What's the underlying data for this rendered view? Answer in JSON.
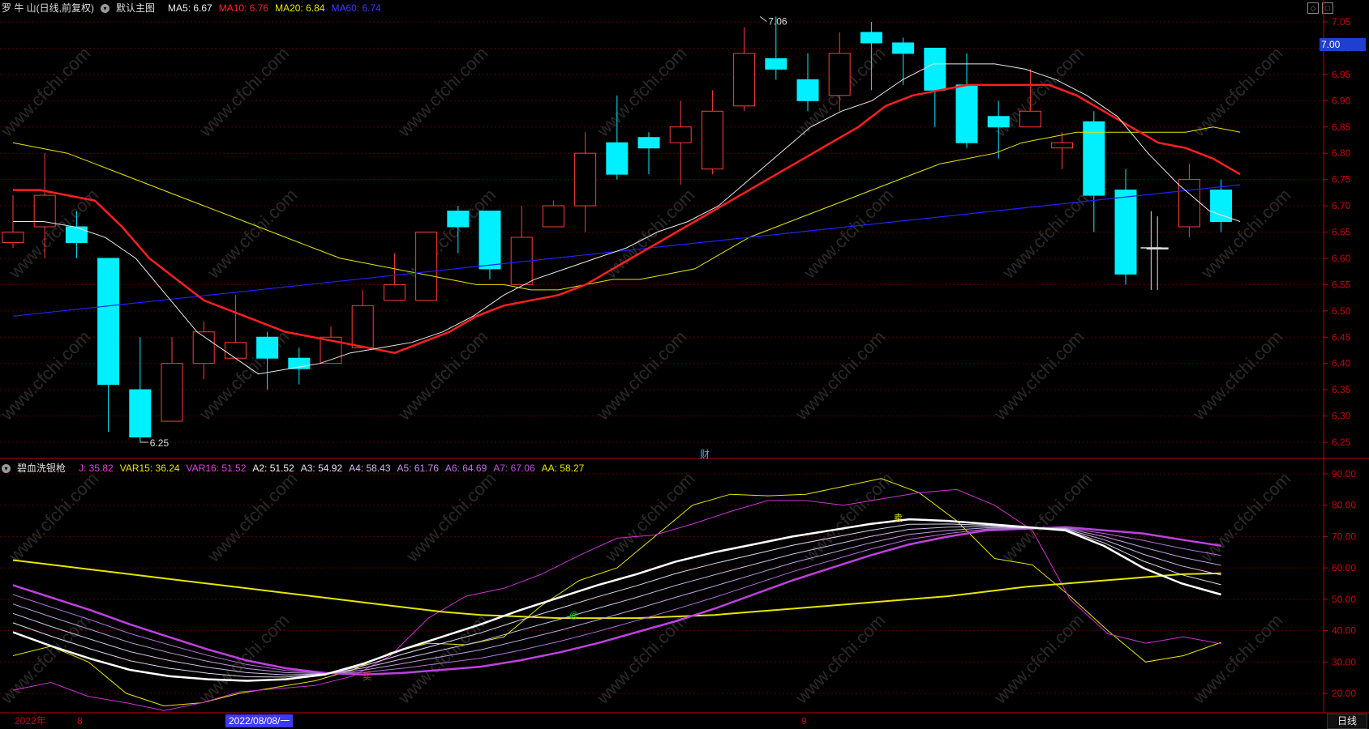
{
  "header_top": {
    "stock": "罗 牛 山(日线,前复权)",
    "main_label": "默认主图",
    "ma5": "MA5: 6.67",
    "ma10": "MA10: 6.76",
    "ma20": "MA20: 6.84",
    "ma60": "MA60: 6.74"
  },
  "header_bottom": {
    "indicator": "碧血洗银枪",
    "j": "J: 35.82",
    "var15": "VAR15: 36.24",
    "var16": "VAR16: 51.52",
    "a2": "A2: 51.52",
    "a3": "A3: 54.92",
    "a4": "A4: 58.43",
    "a5": "A5: 61.76",
    "a6": "A6: 64.69",
    "a7": "A7: 67.06",
    "aa": "AA: 58.27"
  },
  "colors": {
    "up": "#ff3b3b",
    "down": "#00f0ff",
    "ma5": "#e8e8e8",
    "ma10": "#ff1f1f",
    "ma20": "#e6e600",
    "ma60": "#2020ff",
    "grid": "#5a0000",
    "axis": "#c00000"
  },
  "price_axis": {
    "ticks": [
      "7.05",
      "7.00",
      "6.95",
      "6.90",
      "6.85",
      "6.80",
      "6.75",
      "6.70",
      "6.65",
      "6.60",
      "6.55",
      "6.50",
      "6.45",
      "6.40",
      "6.35",
      "6.30",
      "6.25"
    ],
    "current_price": "7.00"
  },
  "indicator_axis": {
    "ticks": [
      "90.00",
      "80.00",
      "70.00",
      "60.00",
      "50.00",
      "40.00",
      "30.00",
      "20.00"
    ]
  },
  "annotations": {
    "high": "7.06",
    "low": "6.25",
    "cai": "财",
    "signal_top": "卖",
    "signal_mid": "@",
    "signal_bottom": "买"
  },
  "x_axis": {
    "year": "2022年",
    "month8": "8",
    "cursor_date": "2022/08/08/一",
    "month9": "9",
    "period_button": "日线"
  },
  "watermark": "www.cfchi.com",
  "chart_data": {
    "type": "candlestick",
    "candles": [
      {
        "o": 6.63,
        "h": 6.72,
        "l": 6.62,
        "c": 6.65
      },
      {
        "o": 6.66,
        "h": 6.8,
        "l": 6.6,
        "c": 6.72
      },
      {
        "o": 6.66,
        "h": 6.69,
        "l": 6.6,
        "c": 6.63
      },
      {
        "o": 6.6,
        "h": 6.6,
        "l": 6.27,
        "c": 6.36
      },
      {
        "o": 6.35,
        "h": 6.45,
        "l": 6.25,
        "c": 6.26
      },
      {
        "o": 6.29,
        "h": 6.45,
        "l": 6.29,
        "c": 6.4
      },
      {
        "o": 6.4,
        "h": 6.48,
        "l": 6.37,
        "c": 6.46
      },
      {
        "o": 6.41,
        "h": 6.53,
        "l": 6.41,
        "c": 6.44
      },
      {
        "o": 6.45,
        "h": 6.46,
        "l": 6.35,
        "c": 6.41
      },
      {
        "o": 6.41,
        "h": 6.43,
        "l": 6.36,
        "c": 6.39
      },
      {
        "o": 6.4,
        "h": 6.47,
        "l": 6.4,
        "c": 6.45
      },
      {
        "o": 6.43,
        "h": 6.54,
        "l": 6.43,
        "c": 6.51
      },
      {
        "o": 6.52,
        "h": 6.61,
        "l": 6.52,
        "c": 6.55
      },
      {
        "o": 6.52,
        "h": 6.65,
        "l": 6.52,
        "c": 6.65
      },
      {
        "o": 6.69,
        "h": 6.7,
        "l": 6.61,
        "c": 6.66
      },
      {
        "o": 6.69,
        "h": 6.69,
        "l": 6.56,
        "c": 6.58
      },
      {
        "o": 6.55,
        "h": 6.7,
        "l": 6.55,
        "c": 6.64
      },
      {
        "o": 6.66,
        "h": 6.71,
        "l": 6.66,
        "c": 6.7
      },
      {
        "o": 6.7,
        "h": 6.84,
        "l": 6.65,
        "c": 6.8
      },
      {
        "o": 6.82,
        "h": 6.91,
        "l": 6.75,
        "c": 6.76
      },
      {
        "o": 6.83,
        "h": 6.84,
        "l": 6.76,
        "c": 6.81
      },
      {
        "o": 6.82,
        "h": 6.9,
        "l": 6.74,
        "c": 6.85
      },
      {
        "o": 6.77,
        "h": 6.92,
        "l": 6.76,
        "c": 6.88
      },
      {
        "o": 6.89,
        "h": 7.04,
        "l": 6.88,
        "c": 6.99
      },
      {
        "o": 6.98,
        "h": 7.06,
        "l": 6.94,
        "c": 6.96
      },
      {
        "o": 6.94,
        "h": 6.99,
        "l": 6.88,
        "c": 6.9
      },
      {
        "o": 6.91,
        "h": 7.03,
        "l": 6.88,
        "c": 6.99
      },
      {
        "o": 7.03,
        "h": 7.05,
        "l": 6.92,
        "c": 7.01
      },
      {
        "o": 7.01,
        "h": 7.02,
        "l": 6.93,
        "c": 6.99
      },
      {
        "o": 7.0,
        "h": 7.0,
        "l": 6.85,
        "c": 6.92
      },
      {
        "o": 6.93,
        "h": 6.99,
        "l": 6.81,
        "c": 6.82
      },
      {
        "o": 6.87,
        "h": 6.9,
        "l": 6.79,
        "c": 6.85
      },
      {
        "o": 6.85,
        "h": 6.96,
        "l": 6.85,
        "c": 6.88
      },
      {
        "o": 6.81,
        "h": 6.84,
        "l": 6.77,
        "c": 6.82
      },
      {
        "o": 6.86,
        "h": 6.88,
        "l": 6.65,
        "c": 6.72
      },
      {
        "o": 6.73,
        "h": 6.77,
        "l": 6.55,
        "c": 6.57
      },
      {
        "o": 6.62,
        "h": 6.68,
        "l": 6.54,
        "c": 6.62
      },
      {
        "o": 6.66,
        "h": 6.78,
        "l": 6.64,
        "c": 6.75
      },
      {
        "o": 6.73,
        "h": 6.75,
        "l": 6.65,
        "c": 6.67
      }
    ],
    "ma5": [
      6.67,
      6.67,
      6.66,
      6.64,
      6.6,
      6.53,
      6.46,
      6.42,
      6.38,
      6.39,
      6.4,
      6.42,
      6.43,
      6.44,
      6.46,
      6.49,
      6.53,
      6.56,
      6.58,
      6.6,
      6.62,
      6.65,
      6.67,
      6.7,
      6.75,
      6.8,
      6.85,
      6.88,
      6.9,
      6.94,
      6.97,
      6.97,
      6.97,
      6.96,
      6.94,
      6.91,
      6.87,
      6.8,
      6.74,
      6.69,
      6.67
    ],
    "ma10": [
      6.73,
      6.73,
      6.72,
      6.71,
      6.66,
      6.6,
      6.56,
      6.52,
      6.5,
      6.48,
      6.46,
      6.45,
      6.44,
      6.43,
      6.42,
      6.44,
      6.46,
      6.49,
      6.51,
      6.52,
      6.53,
      6.55,
      6.58,
      6.61,
      6.64,
      6.67,
      6.7,
      6.73,
      6.76,
      6.79,
      6.82,
      6.85,
      6.89,
      6.91,
      6.92,
      6.93,
      6.93,
      6.93,
      6.93,
      6.91,
      6.88,
      6.85,
      6.82,
      6.81,
      6.79,
      6.76
    ],
    "ma20": [
      6.82,
      6.81,
      6.8,
      6.78,
      6.76,
      6.74,
      6.72,
      6.7,
      6.68,
      6.66,
      6.64,
      6.62,
      6.6,
      6.59,
      6.58,
      6.57,
      6.56,
      6.55,
      6.55,
      6.54,
      6.54,
      6.55,
      6.56,
      6.56,
      6.57,
      6.58,
      6.61,
      6.64,
      6.66,
      6.68,
      6.7,
      6.72,
      6.74,
      6.76,
      6.78,
      6.79,
      6.8,
      6.82,
      6.83,
      6.84,
      6.84,
      6.84,
      6.84,
      6.84,
      6.85,
      6.84
    ],
    "ma60": [
      6.49,
      6.74
    ],
    "indicator": {
      "yrange": [
        15,
        95
      ],
      "AA": [
        62.5,
        61.0,
        59.5,
        58.0,
        56.5,
        55.0,
        53.5,
        52.0,
        50.5,
        49.0,
        47.5,
        46.0,
        45.0,
        44.5,
        44.0,
        44.0,
        44.0,
        44.5,
        45.0,
        46.0,
        47.0,
        48.0,
        49.0,
        50.0,
        51.0,
        52.5,
        54.0,
        55.0,
        56.0,
        57.0,
        58.0,
        58.27
      ],
      "A2": [
        39.5,
        35.0,
        31.0,
        27.5,
        25.5,
        24.5,
        24.0,
        24.5,
        26.0,
        29.5,
        34.0,
        38.0,
        42.0,
        46.5,
        50.5,
        54.5,
        58.0,
        62.0,
        65.0,
        67.5,
        70.0,
        72.0,
        74.0,
        75.5,
        75.0,
        74.0,
        73.0,
        72.0,
        67.0,
        60.0,
        55.0,
        51.52
      ],
      "A7": [
        54.5,
        50.5,
        46.5,
        42.0,
        38.0,
        34.0,
        30.5,
        28.0,
        26.5,
        26.0,
        26.5,
        27.5,
        28.5,
        30.5,
        33.0,
        36.0,
        39.5,
        43.0,
        47.0,
        51.5,
        56.0,
        60.0,
        64.0,
        67.5,
        70.0,
        72.0,
        72.5,
        73.0,
        72.0,
        71.0,
        69.0,
        67.06
      ],
      "VAR15": [
        21.0,
        23.5,
        19.0,
        17.0,
        14.5,
        17.0,
        20.5,
        21.5,
        22.5,
        25.5,
        32.0,
        44.0,
        51.0,
        53.5,
        58.0,
        64.0,
        69.5,
        70.5,
        74.0,
        78.0,
        81.5,
        81.5,
        80.0,
        82.0,
        84.0,
        85.0,
        80.0,
        72.0,
        50.0,
        39.0,
        36.0,
        38.0,
        35.82
      ],
      "VAR16": [
        32.0,
        35.0,
        30.0,
        20.0,
        16.0,
        17.0,
        20.0,
        22.0,
        24.0,
        27.5,
        33.0,
        36.0,
        35.5,
        38.0,
        48.0,
        56.0,
        60.0,
        70.0,
        80.0,
        83.5,
        83.0,
        83.5,
        86.0,
        88.5,
        84.0,
        75.0,
        63.0,
        61.0,
        51.0,
        40.0,
        30.0,
        32.0,
        36.24
      ]
    }
  }
}
